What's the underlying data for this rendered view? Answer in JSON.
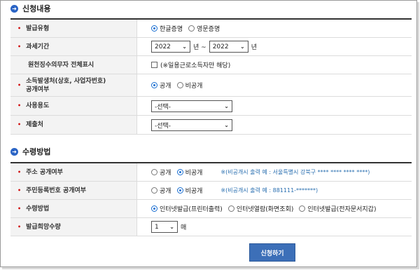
{
  "section1": {
    "title": "신청내용",
    "rows": {
      "issue_type": {
        "label": "발급유형",
        "options": [
          "한글증명",
          "영문증명"
        ],
        "selected": 0
      },
      "tax_period": {
        "label": "과세기간",
        "from": "2022",
        "sep": "년  ~",
        "to": "2022",
        "suffix": "년"
      },
      "withholding": {
        "label": "원천징수의무자 전체표시",
        "checkbox_label": "(※일용근로소득자만 해당)",
        "checked": false
      },
      "disclose_income": {
        "label_line1": "소득발생처(상호, 사업자번호)",
        "label_line2": "공개여부",
        "options": [
          "공개",
          "비공개"
        ],
        "selected": 0
      },
      "purpose": {
        "label": "사용용도",
        "value": "-선택-"
      },
      "submit_to": {
        "label": "제출처",
        "value": "-선택-"
      }
    }
  },
  "section2": {
    "title": "수령방법",
    "rows": {
      "address": {
        "label": "주소 공개여부",
        "options": [
          "공개",
          "비공개"
        ],
        "selected": 1,
        "note": "※(비공개시 출력 예 : 서울특별시 강북구 **** **** **** ****)"
      },
      "rrn": {
        "label": "주민등록번호 공개여부",
        "options": [
          "공개",
          "비공개"
        ],
        "selected": 1,
        "note": "※(비공개시 출력 예 : 881111-*******)"
      },
      "receive_method": {
        "label": "수령방법",
        "options": [
          "인터넷발급(프린터출력)",
          "인터넷열람(화면조회)",
          "인터넷발급(전자문서지갑)"
        ],
        "selected": 0
      },
      "copies": {
        "label": "발급희망수량",
        "value": "1",
        "suffix": "매"
      }
    }
  },
  "submit_label": "신청하기",
  "colors": {
    "accent": "#3c6fb8",
    "required": "#d01010",
    "note": "#2a6fb0"
  }
}
